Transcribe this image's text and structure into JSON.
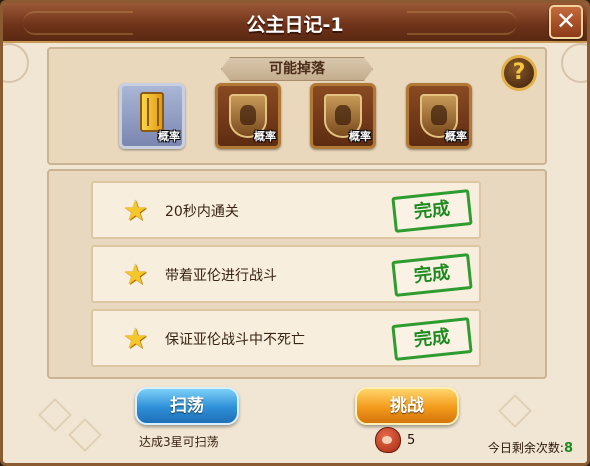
{
  "dialog": {
    "title": "公主日记-1",
    "close_label": "✕",
    "help_label": "?"
  },
  "drops": {
    "header": "可能掉落",
    "items": [
      {
        "icon": "gold-coin-stack-icon",
        "rate_label": "概率",
        "frame": "silver"
      },
      {
        "icon": "weapon-shield-icon",
        "rate_label": "概率",
        "frame": "bronze"
      },
      {
        "icon": "crest-shield-icon",
        "rate_label": "概率",
        "frame": "bronze"
      },
      {
        "icon": "helmet-shield-icon",
        "rate_label": "概率",
        "frame": "bronze"
      }
    ]
  },
  "objectives": [
    {
      "text": "20秒内通关",
      "status": "完成"
    },
    {
      "text": "带着亚伦进行战斗",
      "status": "完成"
    },
    {
      "text": "保证亚伦战斗中不死亡",
      "status": "完成"
    }
  ],
  "actions": {
    "sweep_label": "扫荡",
    "challenge_label": "挑战",
    "sweep_hint": "达成3星可扫荡",
    "stamina_cost": "5",
    "remaining_label": "今日剩余次数:",
    "remaining_value": "8"
  },
  "colors": {
    "title_bar": "#6e3219",
    "panel_bg": "#f1e6d3",
    "stamp_green": "#2f9c2f",
    "sweep_blue": "#2d8fd8",
    "challenge_orange": "#f39a1b",
    "star_gold": "#f6c72a"
  }
}
